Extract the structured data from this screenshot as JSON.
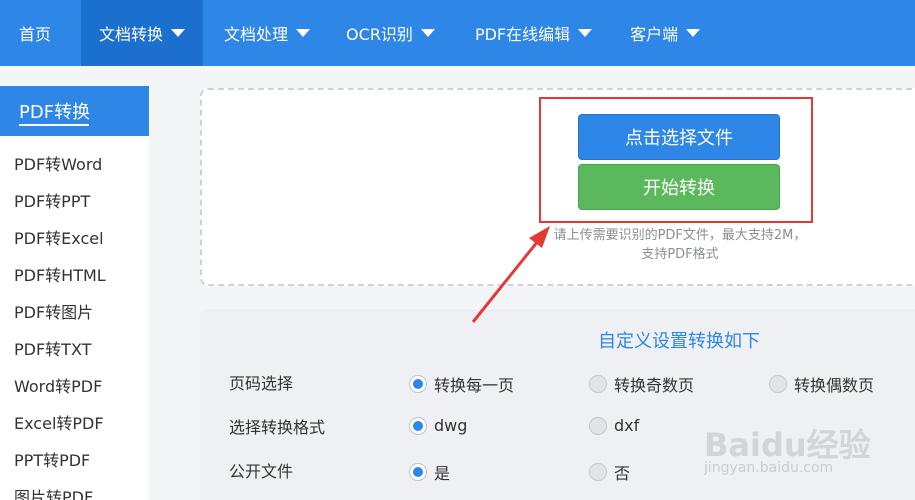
{
  "nav": {
    "items": [
      {
        "label": "首页"
      },
      {
        "label": "文档转换"
      },
      {
        "label": "文档处理"
      },
      {
        "label": "OCR识别"
      },
      {
        "label": "PDF在线编辑"
      },
      {
        "label": "客户端"
      }
    ],
    "active_index": 1
  },
  "sidebar": {
    "title": "PDF转换",
    "items": [
      {
        "label": "PDF转Word"
      },
      {
        "label": "PDF转PPT"
      },
      {
        "label": "PDF转Excel"
      },
      {
        "label": "PDF转HTML"
      },
      {
        "label": "PDF转图片"
      },
      {
        "label": "PDF转TXT"
      },
      {
        "label": "Word转PDF"
      },
      {
        "label": "Excel转PDF"
      },
      {
        "label": "PPT转PDF"
      },
      {
        "label": "图片转PDF"
      }
    ]
  },
  "upload": {
    "choose_button": "点击选择文件",
    "start_button": "开始转换",
    "hint_line1": "请上传需要识别的PDF文件，最大支持2M，",
    "hint_line2": "支持PDF格式"
  },
  "settings": {
    "title": "自定义设置转换如下",
    "page_select": {
      "label": "页码选择",
      "options": [
        "转换每一页",
        "转换奇数页",
        "转换偶数页"
      ],
      "selected": "转换每一页"
    },
    "format_select": {
      "label": "选择转换格式",
      "options": [
        "dwg",
        "dxf"
      ],
      "selected": "dwg"
    },
    "public_file": {
      "label": "公开文件",
      "options": [
        "是",
        "否"
      ],
      "selected": "是"
    }
  },
  "watermark": {
    "logo": "Baidu经验",
    "url": "jingyan.baidu.com"
  },
  "colors": {
    "primary": "#2e86e6",
    "nav_active": "#1a6fcf",
    "success": "#5cb85c",
    "annotation": "#e53935"
  }
}
